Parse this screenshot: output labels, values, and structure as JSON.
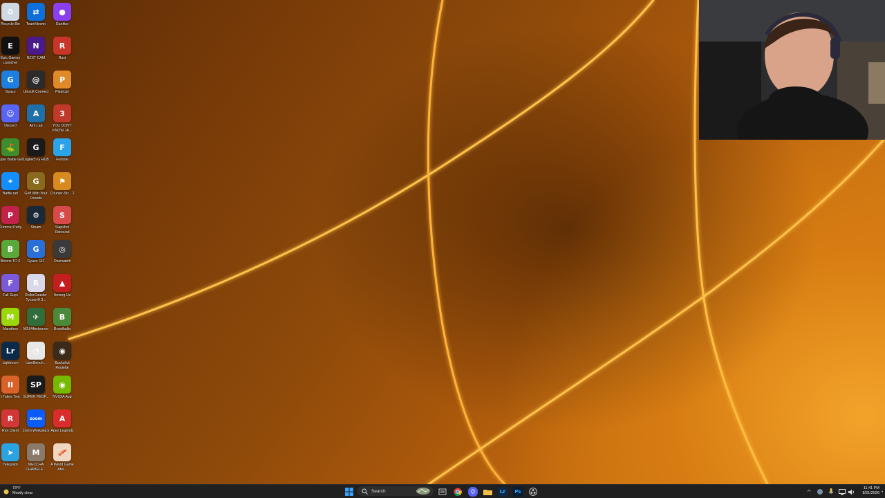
{
  "desktop_icons": [
    {
      "label": "Recycle Bin",
      "icon": "recycle-bin-icon",
      "color": "#cfd8e3",
      "glyph": "♻"
    },
    {
      "label": "TeamViewer",
      "icon": "teamviewer-icon",
      "color": "#0e6fd8",
      "glyph": "⇄"
    },
    {
      "label": "Ganktor",
      "icon": "chat-bubble-icon",
      "color": "#8a3ff0",
      "glyph": "●"
    },
    {
      "label": "Epic Games Launcher",
      "icon": "epic-games-icon",
      "color": "#111111",
      "glyph": "E"
    },
    {
      "label": "NZXT CAM",
      "icon": "nzxt-icon",
      "color": "#4b1a8a",
      "glyph": "N"
    },
    {
      "label": "Rust",
      "icon": "rust-icon",
      "color": "#c8362a",
      "glyph": "R"
    },
    {
      "label": "Gyazo",
      "icon": "gyazo-icon",
      "color": "#1d7fe0",
      "glyph": "G"
    },
    {
      "label": "Ubisoft Connect",
      "icon": "ubisoft-icon",
      "color": "#2b2b2b",
      "glyph": "@"
    },
    {
      "label": "PlateUp!",
      "icon": "plateup-icon",
      "color": "#e08a2a",
      "glyph": "P"
    },
    {
      "label": "Discord",
      "icon": "discord-icon",
      "color": "#5865f2",
      "glyph": "☺"
    },
    {
      "label": "Aim Lab",
      "icon": "aimlab-icon",
      "color": "#1f6fa8",
      "glyph": "A"
    },
    {
      "label": "YOU DON'T KNOW JA...",
      "icon": "ydkj-icon",
      "color": "#c0392b",
      "glyph": "3"
    },
    {
      "label": "Super Battle Golf",
      "icon": "golf-icon",
      "color": "#3f8c2e",
      "glyph": "⛳"
    },
    {
      "label": "Logitech G HUB",
      "icon": "logitech-icon",
      "color": "#1a1a1a",
      "glyph": "G"
    },
    {
      "label": "Fortnite",
      "icon": "fortnite-icon",
      "color": "#2aa3e8",
      "glyph": "F"
    },
    {
      "label": "Battle.net",
      "icon": "battlenet-icon",
      "color": "#148eff",
      "glyph": "✦"
    },
    {
      "label": "Golf With Your Friends",
      "icon": "golf-friends-icon",
      "color": "#8a6a1e",
      "glyph": "G"
    },
    {
      "label": "Counter-Str... 2",
      "icon": "counter-strike-icon",
      "color": "#d98a1e",
      "glyph": "⚑"
    },
    {
      "label": "Pummel Party",
      "icon": "pummel-party-icon",
      "color": "#c0224a",
      "glyph": "P"
    },
    {
      "label": "Steam",
      "icon": "steam-icon",
      "color": "#1b2838",
      "glyph": "⚙"
    },
    {
      "label": "Slapshot Rebound",
      "icon": "slapshot-icon",
      "color": "#d84a4a",
      "glyph": "S"
    },
    {
      "label": "Bloons TD 6",
      "icon": "bloons-icon",
      "color": "#5aa83a",
      "glyph": "B"
    },
    {
      "label": "Gyazo GIF",
      "icon": "gyazo-gif-icon",
      "color": "#2a6fd8",
      "glyph": "G"
    },
    {
      "label": "Overwatch",
      "icon": "overwatch-icon",
      "color": "#3a3a3a",
      "glyph": "◎"
    },
    {
      "label": "Fall Guys",
      "icon": "fall-guys-icon",
      "color": "#7a5ad8",
      "glyph": "F"
    },
    {
      "label": "RollerCoaster Tycoon® 3...",
      "icon": "rollercoaster-icon",
      "color": "#d8d8e8",
      "glyph": "R"
    },
    {
      "label": "Among Us",
      "icon": "among-us-icon",
      "color": "#c41e1e",
      "glyph": "▲"
    },
    {
      "label": "Marathon",
      "icon": "marathon-icon",
      "color": "#9ad80a",
      "glyph": "M"
    },
    {
      "label": "MSI Afterburner",
      "icon": "msi-icon",
      "color": "#2f6e3a",
      "glyph": "✈"
    },
    {
      "label": "Brawlhalla",
      "icon": "brawlhalla-icon",
      "color": "#4a8a3a",
      "glyph": "B"
    },
    {
      "label": "Lightroom",
      "icon": "lightroom-icon",
      "color": "#0b2a4a",
      "glyph": "Lr"
    },
    {
      "label": "UserBench...",
      "icon": "userbench-icon",
      "color": "#e8e8e8",
      "glyph": "◔"
    },
    {
      "label": "Buckshot Roulette",
      "icon": "buckshot-icon",
      "color": "#3a2a1a",
      "glyph": "◉"
    },
    {
      "label": "t Takes Two",
      "icon": "it-takes-two-icon",
      "color": "#d8622a",
      "glyph": "II"
    },
    {
      "label": "SUPER PEOP...",
      "icon": "super-people-icon",
      "color": "#1a1a1a",
      "glyph": "SP"
    },
    {
      "label": "NVIDIA App",
      "icon": "nvidia-icon",
      "color": "#76b900",
      "glyph": "◉"
    },
    {
      "label": "Riot Client",
      "icon": "riot-icon",
      "color": "#d13639",
      "glyph": "R"
    },
    {
      "label": "Zoom Workplace",
      "icon": "zoom-icon",
      "color": "#0b5cff",
      "glyph": "zoom"
    },
    {
      "label": "Apex Legends",
      "icon": "apex-icon",
      "color": "#da2c2c",
      "glyph": "A"
    },
    {
      "label": "Telegram",
      "icon": "telegram-icon",
      "color": "#2aa3e0",
      "glyph": "➤"
    },
    {
      "label": "MECCHA CHAMELE...",
      "icon": "meccha-icon",
      "color": "#8a7a6a",
      "glyph": "M"
    },
    {
      "label": "A Weird Game Abo...",
      "icon": "weird-game-icon",
      "color": "#f0d8c0",
      "glyph": "🥓"
    }
  ],
  "taskbar": {
    "weather": {
      "temp": "73°F",
      "condition": "Mostly clear"
    },
    "search_label": "Search",
    "apps": [
      {
        "name": "start-button-icon",
        "color": "#3aa0ff"
      },
      {
        "name": "task-view-icon",
        "color": "#cccccc"
      },
      {
        "name": "chrome-icon",
        "color": "#34a853"
      },
      {
        "name": "discord-taskbar-icon",
        "color": "#5865f2"
      },
      {
        "name": "file-explorer-icon",
        "color": "#f2c14a"
      },
      {
        "name": "lightroom-taskbar-icon",
        "color": "#0b2a4a"
      },
      {
        "name": "photoshop-taskbar-icon",
        "color": "#001e36"
      },
      {
        "name": "obs-icon",
        "color": "#303030"
      }
    ],
    "clock": {
      "time": "11:41 PM",
      "date": "8/21/2026"
    }
  },
  "colors": {
    "accent": "#f29a1a",
    "taskbar": "#202020"
  }
}
